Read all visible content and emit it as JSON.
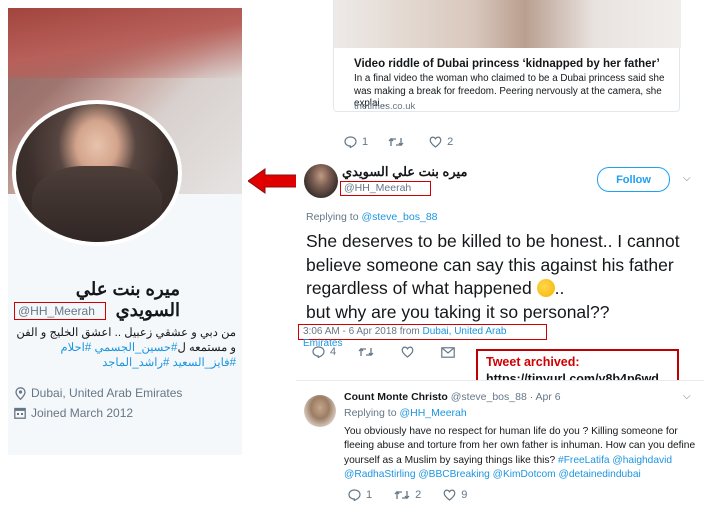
{
  "profile": {
    "name": "ميره بنت علي السويدي",
    "handle": "@HH_Meerah",
    "bio_line1": "من دبي و عشقي زعبيل .. اعشق الخليج و الفن",
    "bio_line2_prefix": "و مستمعه ل",
    "bio_tag1": "#حسين_الجسمي",
    "bio_tag2": "#احلام",
    "bio_tag3": "#فايز_السعيد",
    "bio_tag4": "#راشد_الماجد",
    "location": "Dubai, United Arab Emirates",
    "joined": "Joined March 2012",
    "icons": {
      "location": "location-pin-icon",
      "joined": "calendar-icon"
    }
  },
  "embedded_tweet": {
    "card_title": "Video riddle of Dubai princess ‘kidnapped by her father’",
    "card_desc": "In a final video the woman who claimed to be a Dubai princess said she was making a break for freedom. Peering nervously at the camera, she explai...",
    "card_domain": "thetimes.co.uk",
    "replies": "1",
    "retweets": "",
    "likes": "2"
  },
  "main_tweet": {
    "name": "ميره بنت علي السويدي",
    "handle": "@HH_Meerah",
    "follow_label": "Follow",
    "replying_prefix": "Replying to ",
    "replying_handle": "@steve_bos_88",
    "text_part1": "She deserves to be killed to be honest.. I cannot believe someone can say this against his father regardless of what happened ",
    "text_part2": "..",
    "text_part3": "but why are you taking it so personal??",
    "timestamp": "3:06 AM - 6 Apr 2018 from ",
    "location": "Dubai, United Arab Emirates",
    "replies": "4",
    "retweets": "",
    "likes": ""
  },
  "archive_note": {
    "line1": "Tweet archived:",
    "line2": "https://tinyurl.com/y8b4p6wd"
  },
  "reply_tweet": {
    "name": "Count Monte Christo",
    "handle_date": " @steve_bos_88 · Apr 6",
    "replying_prefix": "Replying to ",
    "replying_handle": "@HH_Meerah",
    "text": "You obviously have no respect for human life do you ? Killing someone for fleeing abuse and torture from her own father is inhuman. How can you define yourself as a Muslim by saying things like this? ",
    "tags": "#FreeLatifa @haighdavid @RadhaStirling @BBCBreaking @KimDotcom @detainedindubai",
    "replies": "1",
    "retweets": "2",
    "likes": "9"
  },
  "colors": {
    "accent": "#1da1f2",
    "highlight": "#d00000",
    "muted": "#657786"
  }
}
